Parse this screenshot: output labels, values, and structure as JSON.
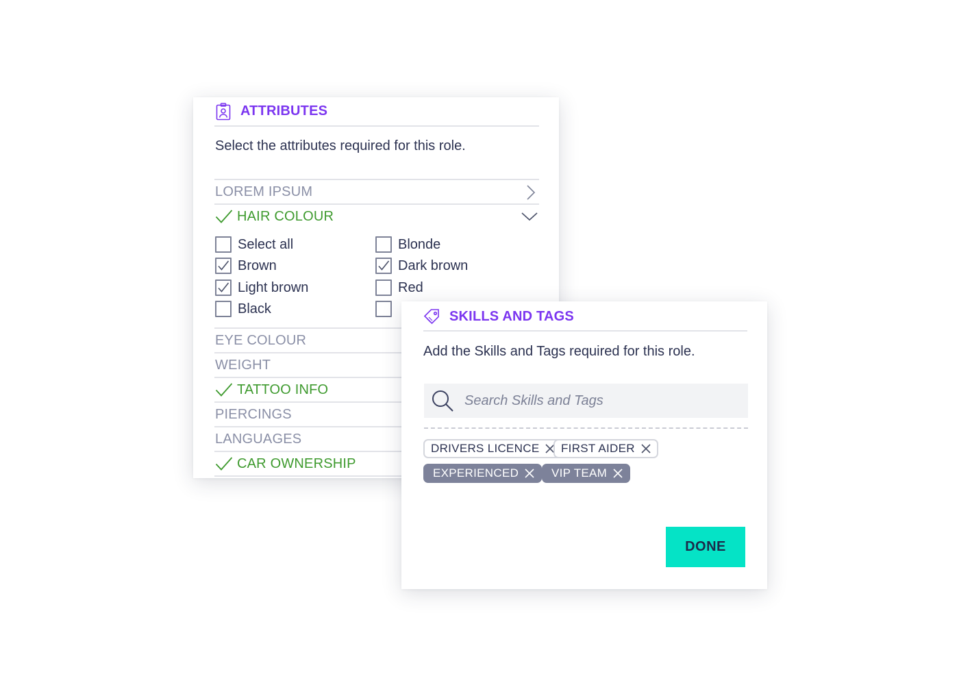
{
  "colors": {
    "accent": "#7b35f0",
    "complete": "#3e9a2e",
    "muted_text": "#8a8fa6",
    "body_text": "#2b3150",
    "done_button": "#05e3c6",
    "filled_tag": "#7d829a"
  },
  "attributes": {
    "title": "ATTRIBUTES",
    "icon": "id-badge-icon",
    "description": "Select the attributes required for this role.",
    "sections": [
      {
        "label": "LOREM IPSUM",
        "complete": false,
        "state": "collapsed",
        "icon": "chevron-right-icon"
      },
      {
        "label": "HAIR COLOUR",
        "complete": true,
        "state": "expanded",
        "icon": "chevron-down-icon"
      },
      {
        "label": "EYE COLOUR",
        "complete": false
      },
      {
        "label": "WEIGHT",
        "complete": false
      },
      {
        "label": "TATTOO INFO",
        "complete": true
      },
      {
        "label": "PIERCINGS",
        "complete": false
      },
      {
        "label": "LANGUAGES",
        "complete": false
      },
      {
        "label": "CAR OWNERSHIP",
        "complete": true
      }
    ],
    "hair_colour_options": [
      {
        "label": "Select all",
        "checked": false
      },
      {
        "label": "Blonde",
        "checked": false
      },
      {
        "label": "Brown",
        "checked": true
      },
      {
        "label": "Dark brown",
        "checked": true
      },
      {
        "label": "Light brown",
        "checked": true
      },
      {
        "label": "Red",
        "checked": false
      },
      {
        "label": "Black",
        "checked": false
      },
      {
        "label": "",
        "checked": false
      }
    ]
  },
  "skills": {
    "title": "SKILLS AND TAGS",
    "icon": "tag-icon",
    "description": "Add the Skills and Tags required for this role.",
    "search": {
      "placeholder": "Search Skills and Tags",
      "value": ""
    },
    "tags": [
      {
        "label": "DRIVERS LICENCE",
        "style": "outline"
      },
      {
        "label": "FIRST AIDER",
        "style": "outline"
      },
      {
        "label": "EXPERIENCED",
        "style": "filled"
      },
      {
        "label": "VIP TEAM",
        "style": "filled"
      }
    ],
    "done_label": "DONE"
  }
}
